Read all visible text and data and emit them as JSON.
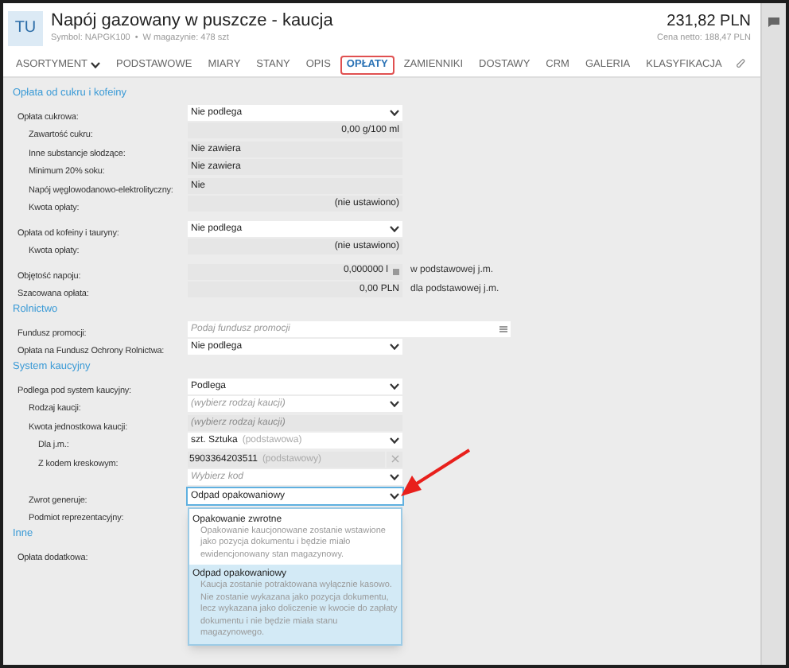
{
  "header": {
    "avatar": "TU",
    "title": "Napój gazowany w puszcze - kaucja",
    "symbol": "Symbol: NAPGK100",
    "separator": "•",
    "stock": "W magazynie: 478 szt",
    "price": "231,82 PLN",
    "net_price": "Cena netto: 188,47 PLN"
  },
  "tabs": [
    {
      "label": "ASORTYMENT",
      "selected": false,
      "menu": true
    },
    {
      "label": "PODSTAWOWE",
      "selected": false
    },
    {
      "label": "MIARY",
      "selected": false
    },
    {
      "label": "STANY",
      "selected": false
    },
    {
      "label": "OPIS",
      "selected": false
    },
    {
      "label": "OPŁATY",
      "selected": true
    },
    {
      "label": "ZAMIENNIKI",
      "selected": false
    },
    {
      "label": "DOSTAWY",
      "selected": false
    },
    {
      "label": "CRM",
      "selected": false
    },
    {
      "label": "GALERIA",
      "selected": false
    },
    {
      "label": "KLASYFIKACJA",
      "selected": false
    }
  ],
  "sections": [
    {
      "title": "Opłata od cukru i kofeiny",
      "groups": [
        {
          "rows": [
            {
              "label": "Opłata cukrowa:",
              "field": {
                "kind": "select",
                "value": "Nie podlega"
              },
              "children": [
                {
                  "label": "Zawartość cukru:",
                  "field": {
                    "kind": "number",
                    "value": "0,00 g/100 ml"
                  }
                },
                {
                  "label": "Inne substancje słodzące:",
                  "field": {
                    "kind": "text",
                    "value": "Nie zawiera"
                  }
                },
                {
                  "label": "Minimum 20% soku:",
                  "field": {
                    "kind": "text",
                    "value": "Nie zawiera"
                  }
                },
                {
                  "label": "Napój węglowodanowo-elektrolityczny:",
                  "field": {
                    "kind": "text",
                    "value": "Nie"
                  }
                },
                {
                  "label": "Kwota opłaty:",
                  "field": {
                    "kind": "number",
                    "value": "(nie ustawiono)"
                  }
                }
              ]
            }
          ]
        },
        {
          "rows": [
            {
              "label": "Opłata od kofeiny i tauryny:",
              "field": {
                "kind": "select",
                "value": "Nie podlega"
              },
              "children": [
                {
                  "label": "Kwota opłaty:",
                  "field": {
                    "kind": "number",
                    "value": "(nie ustawiono)"
                  }
                }
              ]
            }
          ]
        },
        {
          "rows": [
            {
              "label": "Objętość napoju:",
              "field": {
                "kind": "calc",
                "value": "0,000000 l"
              },
              "suffix": "w podstawowej j.m."
            },
            {
              "label": "Szacowana opłata:",
              "field": {
                "kind": "number",
                "value": "0,00 PLN"
              },
              "suffix": "dla podstawowej j.m."
            }
          ]
        }
      ]
    },
    {
      "title": "Rolnictwo",
      "groups": [
        {
          "rows": [
            {
              "label": "Fundusz promocji:",
              "field": {
                "kind": "input",
                "placeholder": "Podaj fundusz promocji"
              }
            },
            {
              "label": "Opłata na Fundusz Ochrony Rolnictwa:",
              "field": {
                "kind": "select",
                "value": "Nie podlega"
              }
            }
          ]
        }
      ]
    },
    {
      "title": "System kaucyjny",
      "groups": [
        {
          "rows": [
            {
              "label": "Podlega pod system kaucyjny:",
              "field": {
                "kind": "select",
                "value": "Podlega"
              },
              "children": [
                {
                  "label": "Rodzaj kaucji:",
                  "field": {
                    "kind": "select",
                    "placeholder": "(wybierz rodzaj kaucji)"
                  }
                },
                {
                  "label": "Kwota jednostkowa kaucji:",
                  "field": {
                    "kind": "text",
                    "placeholder": "(wybierz rodzaj kaucji)"
                  },
                  "children": [
                    {
                      "label": "Dla j.m.:",
                      "field": {
                        "kind": "select",
                        "value": "szt. Sztuka",
                        "note": "(podstawowa)"
                      }
                    },
                    {
                      "label": "Z kodem kreskowym:",
                      "field": {
                        "kind": "barcode",
                        "value": "5903364203511",
                        "note": "(podstawowy)"
                      }
                    },
                    {
                      "field": {
                        "kind": "select",
                        "placeholder": "Wybierz kod"
                      }
                    }
                  ]
                },
                {
                  "label": "Zwrot generuje:",
                  "field": {
                    "kind": "select",
                    "value": "Odpad opakowaniowy",
                    "expanded": true,
                    "options": [
                      {
                        "title": "Opakowanie zwrotne",
                        "description": "Opakowanie kaucjonowane zostanie wstawione jako pozycja dokumentu i będzie miało ewidencjonowany stan magazynowy.",
                        "selected": false
                      },
                      {
                        "title": "Odpad opakowaniowy",
                        "description": "Kaucja zostanie potraktowana wyłącznie kasowo. Nie zostanie wykazana jako pozycja dokumentu, lecz wykazana jako doliczenie w kwocie do zapłaty dokumentu i nie będzie miała stanu magazynowego.",
                        "selected": true
                      }
                    ]
                  }
                },
                {
                  "label": "Podmiot reprezentacyjny:"
                }
              ]
            }
          ]
        }
      ]
    },
    {
      "title": "Inne",
      "groups": [
        {
          "rows": [
            {
              "label": "Opłata dodatkowa:"
            }
          ]
        }
      ]
    }
  ]
}
